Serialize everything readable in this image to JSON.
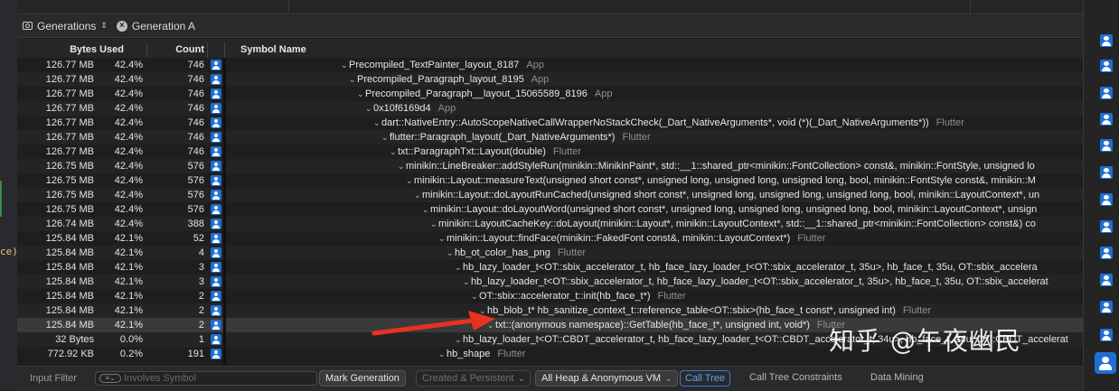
{
  "navigator": {
    "generations_label": "Generations",
    "generation_a_label": "Generation A"
  },
  "columns": {
    "bytes_used": "Bytes Used",
    "count": "Count",
    "symbol_name": "Symbol Name"
  },
  "rows": [
    {
      "bytes": "126.77 MB",
      "pct": "42.4%",
      "count": "746",
      "depth": 0,
      "symbol": "Precompiled_TextPainter_layout_8187",
      "lib": "App"
    },
    {
      "bytes": "126.77 MB",
      "pct": "42.4%",
      "count": "746",
      "depth": 1,
      "symbol": "Precompiled_Paragraph_layout_8195",
      "lib": "App"
    },
    {
      "bytes": "126.77 MB",
      "pct": "42.4%",
      "count": "746",
      "depth": 2,
      "symbol": "Precompiled_Paragraph__layout_15065589_8196",
      "lib": "App"
    },
    {
      "bytes": "126.77 MB",
      "pct": "42.4%",
      "count": "746",
      "depth": 3,
      "symbol": "0x10f6169d4",
      "lib": "App"
    },
    {
      "bytes": "126.77 MB",
      "pct": "42.4%",
      "count": "746",
      "depth": 4,
      "symbol": "dart::NativeEntry::AutoScopeNativeCallWrapperNoStackCheck(_Dart_NativeArguments*, void (*)(_Dart_NativeArguments*))",
      "lib": "Flutter"
    },
    {
      "bytes": "126.77 MB",
      "pct": "42.4%",
      "count": "746",
      "depth": 5,
      "symbol": "flutter::Paragraph_layout(_Dart_NativeArguments*)",
      "lib": "Flutter"
    },
    {
      "bytes": "126.77 MB",
      "pct": "42.4%",
      "count": "746",
      "depth": 6,
      "symbol": "txt::ParagraphTxt::Layout(double)",
      "lib": "Flutter"
    },
    {
      "bytes": "126.75 MB",
      "pct": "42.4%",
      "count": "576",
      "depth": 7,
      "symbol": "minikin::LineBreaker::addStyleRun(minikin::MinikinPaint*, std::__1::shared_ptr<minikin::FontCollection> const&, minikin::FontStyle, unsigned lo",
      "lib": ""
    },
    {
      "bytes": "126.75 MB",
      "pct": "42.4%",
      "count": "576",
      "depth": 8,
      "symbol": "minikin::Layout::measureText(unsigned short const*, unsigned long, unsigned long, unsigned long, bool, minikin::FontStyle const&, minikin::M",
      "lib": ""
    },
    {
      "bytes": "126.75 MB",
      "pct": "42.4%",
      "count": "576",
      "depth": 9,
      "symbol": "minikin::Layout::doLayoutRunCached(unsigned short const*, unsigned long, unsigned long, unsigned long, bool, minikin::LayoutContext*, un",
      "lib": ""
    },
    {
      "bytes": "126.75 MB",
      "pct": "42.4%",
      "count": "576",
      "depth": 10,
      "symbol": "minikin::Layout::doLayoutWord(unsigned short const*, unsigned long, unsigned long, unsigned long, bool, minikin::LayoutContext*, unsign",
      "lib": ""
    },
    {
      "bytes": "126.74 MB",
      "pct": "42.4%",
      "count": "388",
      "depth": 11,
      "symbol": "minikin::LayoutCacheKey::doLayout(minikin::Layout*, minikin::LayoutContext*, std::__1::shared_ptr<minikin::FontCollection> const&) co",
      "lib": ""
    },
    {
      "bytes": "125.84 MB",
      "pct": "42.1%",
      "count": "52",
      "depth": 12,
      "symbol": "minikin::Layout::findFace(minikin::FakedFont const&, minikin::LayoutContext*)",
      "lib": "Flutter"
    },
    {
      "bytes": "125.84 MB",
      "pct": "42.1%",
      "count": "4",
      "depth": 13,
      "symbol": "hb_ot_color_has_png",
      "lib": "Flutter"
    },
    {
      "bytes": "125.84 MB",
      "pct": "42.1%",
      "count": "3",
      "depth": 14,
      "symbol": "hb_lazy_loader_t<OT::sbix_accelerator_t, hb_face_lazy_loader_t<OT::sbix_accelerator_t, 35u>, hb_face_t, 35u, OT::sbix_accelera",
      "lib": ""
    },
    {
      "bytes": "125.84 MB",
      "pct": "42.1%",
      "count": "3",
      "depth": 15,
      "symbol": "hb_lazy_loader_t<OT::sbix_accelerator_t, hb_face_lazy_loader_t<OT::sbix_accelerator_t, 35u>, hb_face_t, 35u, OT::sbix_accelerat",
      "lib": ""
    },
    {
      "bytes": "125.84 MB",
      "pct": "42.1%",
      "count": "2",
      "depth": 16,
      "symbol": "OT::sbix::accelerator_t::init(hb_face_t*)",
      "lib": "Flutter"
    },
    {
      "bytes": "125.84 MB",
      "pct": "42.1%",
      "count": "2",
      "depth": 17,
      "symbol": "hb_blob_t* hb_sanitize_context_t::reference_table<OT::sbix>(hb_face_t const*, unsigned int)",
      "lib": "Flutter"
    },
    {
      "bytes": "125.84 MB",
      "pct": "42.1%",
      "count": "2",
      "depth": 18,
      "symbol": "txt::(anonymous namespace)::GetTable(hb_face_t*, unsigned int, void*)",
      "lib": "Flutter",
      "selected": true
    },
    {
      "bytes": "32 Bytes",
      "pct": "0.0%",
      "count": "1",
      "depth": 14,
      "symbol": "hb_lazy_loader_t<OT::CBDT_accelerator_t, hb_face_lazy_loader_t<OT::CBDT_accelerator_t, 34u>, hb_face_t, 34u, OT::CBDT_accelerat",
      "lib": ""
    },
    {
      "bytes": "772.92 KB",
      "pct": "0.2%",
      "count": "191",
      "depth": 12,
      "symbol": "hb_shape",
      "lib": "Flutter"
    }
  ],
  "bottom_bar": {
    "input_filter_label": "Input Filter",
    "filter_placeholder": "Involves Symbol",
    "mark_generation": "Mark Generation",
    "created_persistent": "Created & Persistent",
    "heap_vm": "All Heap & Anonymous VM",
    "call_tree": "Call Tree",
    "call_tree_constraints": "Call Tree Constraints",
    "data_mining": "Data Mining"
  },
  "watermark": "知乎 @午夜幽民",
  "editor_fragment": "ce)",
  "colors": {
    "accent": "#1f6ed4",
    "arrow": "#e8321e",
    "link": "#5fa2ff"
  }
}
